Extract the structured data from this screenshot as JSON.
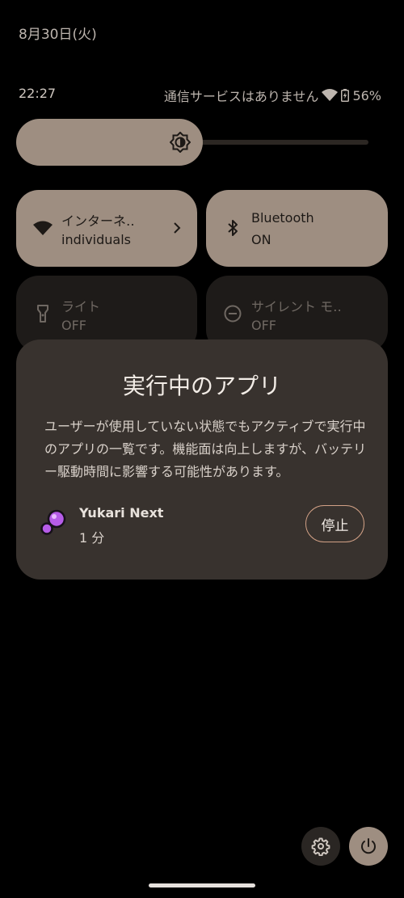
{
  "header": {
    "date": "8月30日(火)"
  },
  "status_bar": {
    "time": "22:27",
    "carrier": "通信サービスはありません",
    "battery": "56%",
    "icons": [
      "wifi-icon",
      "battery-charging-icon"
    ]
  },
  "brightness": {
    "level_fraction": 0.53,
    "icon": "brightness-icon"
  },
  "tiles": [
    {
      "title": "インターネ‥",
      "subtitle": "individuals",
      "state": "on",
      "icon": "wifi-icon",
      "has_chevron": true
    },
    {
      "title": "Bluetooth",
      "subtitle": "ON",
      "state": "on",
      "icon": "bluetooth-icon"
    },
    {
      "title": "ライト",
      "subtitle": "OFF",
      "state": "off",
      "icon": "flashlight-icon"
    },
    {
      "title": "サイレント モ‥",
      "subtitle": "OFF",
      "state": "off",
      "icon": "do-not-disturb-icon"
    }
  ],
  "dialog": {
    "title": "実行中のアプリ",
    "body": "ユーザーが使用していない状態でもアクティブで実行中のアプリの一覧です。機能面は向上しますが、バッテリー駆動時間に影響する可能性があります。",
    "apps": [
      {
        "name": "Yukari Next",
        "duration": "1 分",
        "stop_label": "停止"
      }
    ]
  },
  "bottom": {
    "icons": [
      "gear-icon",
      "power-icon"
    ]
  },
  "colors": {
    "tile_on": "#9e8e81",
    "tile_off": "#1e1b19",
    "dialog_bg": "#38322e",
    "accent_outline": "#d2a186"
  }
}
